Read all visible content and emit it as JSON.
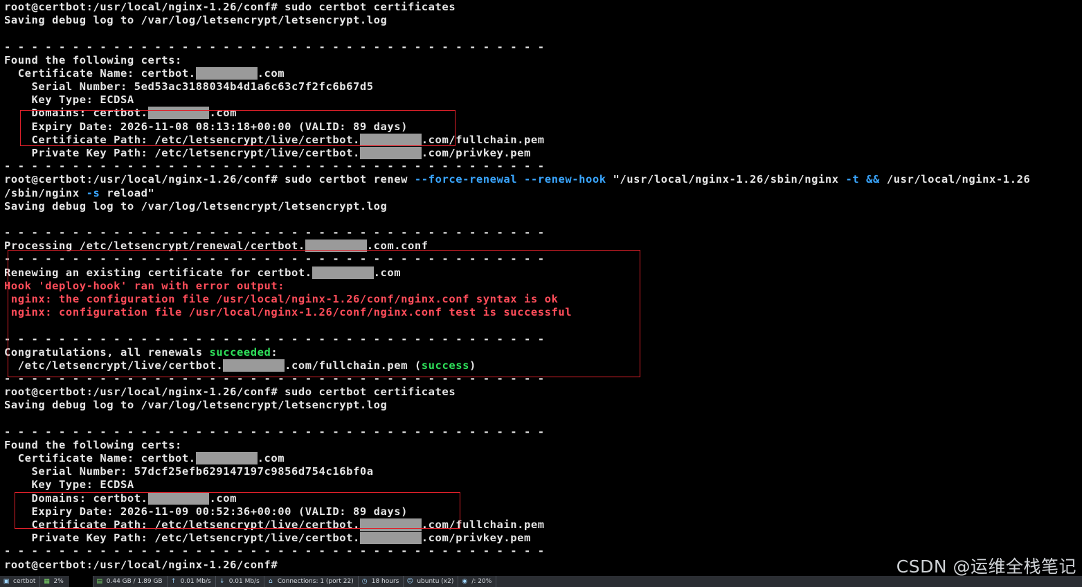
{
  "terminal": {
    "lines": [
      {
        "segments": [
          {
            "text": "root@certbot:/usr/local/nginx-1.26/conf# sudo certbot certificates"
          }
        ]
      },
      {
        "segments": [
          {
            "text": "Saving debug log to /var/log/letsencrypt/letsencrypt.log"
          }
        ]
      },
      {
        "segments": [
          {
            "text": ""
          }
        ]
      },
      {
        "segments": [
          {
            "text": "- - - - - - - - - - - - - - - - - - - - - - - - - - - - - - - - - - - - - - - -"
          }
        ]
      },
      {
        "segments": [
          {
            "text": "Found the following certs:"
          }
        ]
      },
      {
        "segments": [
          {
            "text": "  Certificate Name: certbot."
          },
          {
            "text": "         ",
            "style": "mask"
          },
          {
            "text": ".com"
          }
        ]
      },
      {
        "segments": [
          {
            "text": "    Serial Number: 5ed53ac3188034b4d1a6c63c7f2fc6b67d5"
          }
        ]
      },
      {
        "segments": [
          {
            "text": "    Key Type: ECDSA"
          }
        ]
      },
      {
        "segments": [
          {
            "text": "    Domains: certbot."
          },
          {
            "text": "         ",
            "style": "mask"
          },
          {
            "text": ".com"
          }
        ]
      },
      {
        "segments": [
          {
            "text": "    Expiry Date: 2026-11-08 08:13:18+00:00 (VALID: 89 days)"
          }
        ]
      },
      {
        "segments": [
          {
            "text": "    Certificate Path: /etc/letsencrypt/live/certbot."
          },
          {
            "text": "         ",
            "style": "mask"
          },
          {
            "text": ".com/fullchain.pem"
          }
        ]
      },
      {
        "segments": [
          {
            "text": "    Private Key Path: /etc/letsencrypt/live/certbot."
          },
          {
            "text": "         ",
            "style": "mask"
          },
          {
            "text": ".com/privkey.pem"
          }
        ]
      },
      {
        "segments": [
          {
            "text": "- - - - - - - - - - - - - - - - - - - - - - - - - - - - - - - - - - - - - - - -"
          }
        ]
      },
      {
        "segments": [
          {
            "text": "root@certbot:/usr/local/nginx-1.26/conf# sudo certbot renew "
          },
          {
            "text": "--force-renewal",
            "style": "blue"
          },
          {
            "text": " "
          },
          {
            "text": "--renew-hook",
            "style": "blue"
          },
          {
            "text": " \"/usr/local/nginx-1.26/sbin/nginx "
          },
          {
            "text": "-t",
            "style": "blue"
          },
          {
            "text": " "
          },
          {
            "text": "&&",
            "style": "blue"
          },
          {
            "text": " /usr/local/nginx-1.26"
          }
        ]
      },
      {
        "segments": [
          {
            "text": "/sbin/nginx "
          },
          {
            "text": "-s",
            "style": "blue"
          },
          {
            "text": " reload\""
          }
        ]
      },
      {
        "segments": [
          {
            "text": "Saving debug log to /var/log/letsencrypt/letsencrypt.log"
          }
        ]
      },
      {
        "segments": [
          {
            "text": ""
          }
        ]
      },
      {
        "segments": [
          {
            "text": "- - - - - - - - - - - - - - - - - - - - - - - - - - - - - - - - - - - - - - - -"
          }
        ]
      },
      {
        "segments": [
          {
            "text": "Processing /etc/letsencrypt/renewal/certbot."
          },
          {
            "text": "         ",
            "style": "mask"
          },
          {
            "text": ".com.conf"
          }
        ]
      },
      {
        "segments": [
          {
            "text": "- - - - - - - - - - - - - - - - - - - - - - - - - - - - - - - - - - - - - - - -"
          }
        ]
      },
      {
        "segments": [
          {
            "text": "Renewing an existing certificate for certbot."
          },
          {
            "text": "         ",
            "style": "mask"
          },
          {
            "text": ".com"
          }
        ]
      },
      {
        "segments": [
          {
            "text": "Hook 'deploy-hook' ran with error output:",
            "style": "red"
          }
        ]
      },
      {
        "segments": [
          {
            "text": " nginx: the configuration file /usr/local/nginx-1.26/conf/nginx.conf syntax is ok",
            "style": "red"
          }
        ]
      },
      {
        "segments": [
          {
            "text": " nginx: configuration file /usr/local/nginx-1.26/conf/nginx.conf test is successful",
            "style": "red"
          }
        ]
      },
      {
        "segments": [
          {
            "text": ""
          }
        ]
      },
      {
        "segments": [
          {
            "text": "- - - - - - - - - - - - - - - - - - - - - - - - - - - - - - - - - - - - - - - -"
          }
        ]
      },
      {
        "segments": [
          {
            "text": "Congratulations, all renewals "
          },
          {
            "text": "succeeded",
            "style": "green"
          },
          {
            "text": ":"
          }
        ]
      },
      {
        "segments": [
          {
            "text": "  /etc/letsencrypt/live/certbot."
          },
          {
            "text": "         ",
            "style": "mask"
          },
          {
            "text": ".com/fullchain.pem ("
          },
          {
            "text": "success",
            "style": "green"
          },
          {
            "text": ")"
          }
        ]
      },
      {
        "segments": [
          {
            "text": "- - - - - - - - - - - - - - - - - - - - - - - - - - - - - - - - - - - - - - - -"
          }
        ]
      },
      {
        "segments": [
          {
            "text": "root@certbot:/usr/local/nginx-1.26/conf# sudo certbot certificates"
          }
        ]
      },
      {
        "segments": [
          {
            "text": "Saving debug log to /var/log/letsencrypt/letsencrypt.log"
          }
        ]
      },
      {
        "segments": [
          {
            "text": ""
          }
        ]
      },
      {
        "segments": [
          {
            "text": "- - - - - - - - - - - - - - - - - - - - - - - - - - - - - - - - - - - - - - - -"
          }
        ]
      },
      {
        "segments": [
          {
            "text": "Found the following certs:"
          }
        ]
      },
      {
        "segments": [
          {
            "text": "  Certificate Name: certbot."
          },
          {
            "text": "         ",
            "style": "mask"
          },
          {
            "text": ".com"
          }
        ]
      },
      {
        "segments": [
          {
            "text": "    Serial Number: 57dcf25efb629147197c9856d754c16bf0a"
          }
        ]
      },
      {
        "segments": [
          {
            "text": "    Key Type: ECDSA"
          }
        ]
      },
      {
        "segments": [
          {
            "text": "    Domains: certbot."
          },
          {
            "text": "         ",
            "style": "mask"
          },
          {
            "text": ".com"
          }
        ]
      },
      {
        "segments": [
          {
            "text": "    Expiry Date: 2026-11-09 00:52:36+00:00 (VALID: 89 days)"
          }
        ]
      },
      {
        "segments": [
          {
            "text": "    Certificate Path: /etc/letsencrypt/live/certbot."
          },
          {
            "text": "         ",
            "style": "mask"
          },
          {
            "text": ".com/fullchain.pem"
          }
        ]
      },
      {
        "segments": [
          {
            "text": "    Private Key Path: /etc/letsencrypt/live/certbot."
          },
          {
            "text": "         ",
            "style": "mask"
          },
          {
            "text": ".com/privkey.pem"
          }
        ]
      },
      {
        "segments": [
          {
            "text": "- - - - - - - - - - - - - - - - - - - - - - - - - - - - - - - - - - - - - - - -"
          }
        ]
      },
      {
        "segments": [
          {
            "text": "root@certbot:/usr/local/nginx-1.26/conf#"
          }
        ]
      }
    ]
  },
  "watermark": "CSDN @运维全栈笔记",
  "statusbar": {
    "host": "certbot",
    "cpu": "2%",
    "memory": "0.44 GB / 1.89 GB",
    "upload": "0.01 Mb/s",
    "download": "0.01 Mb/s",
    "connections": "Connections: 1 (port 22)",
    "uptime": "18 hours",
    "users": "ubuntu (x2)",
    "disk": "/: 20%"
  },
  "colors": {
    "background": "#000000",
    "text": "#e6e6e6",
    "error": "#ff4d5a",
    "success": "#2ee05a",
    "option": "#3aa6ff",
    "highlight_box": "#e0202a"
  }
}
